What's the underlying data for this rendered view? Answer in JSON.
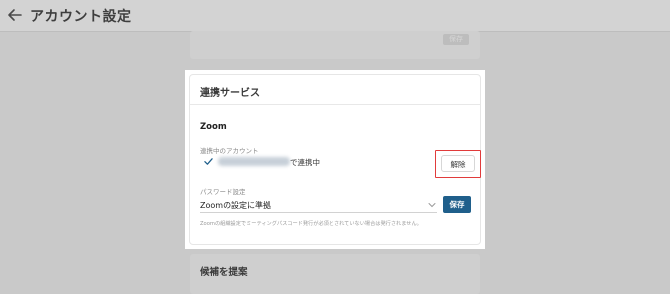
{
  "header": {
    "title": "アカウント設定",
    "back_icon": "arrow-left-icon"
  },
  "background_cards": {
    "top_button_label": "保存",
    "bottom_title": "候補を提案"
  },
  "linked_services": {
    "title": "連携サービス",
    "service_name": "Zoom",
    "linked_account_label": "連携中のアカウント",
    "linked_suffix": "で連携中",
    "unlink_button": "解除",
    "password_label": "パスワード設定",
    "password_selected": "Zoomの設定に準拠",
    "save_button": "保存",
    "note": "Zoomの組織設定でミーティングパスコード発行が必須とされていない場合は発行されません。"
  },
  "colors": {
    "highlight_outline": "#e13b3b",
    "primary_button": "#1f5f8b"
  }
}
